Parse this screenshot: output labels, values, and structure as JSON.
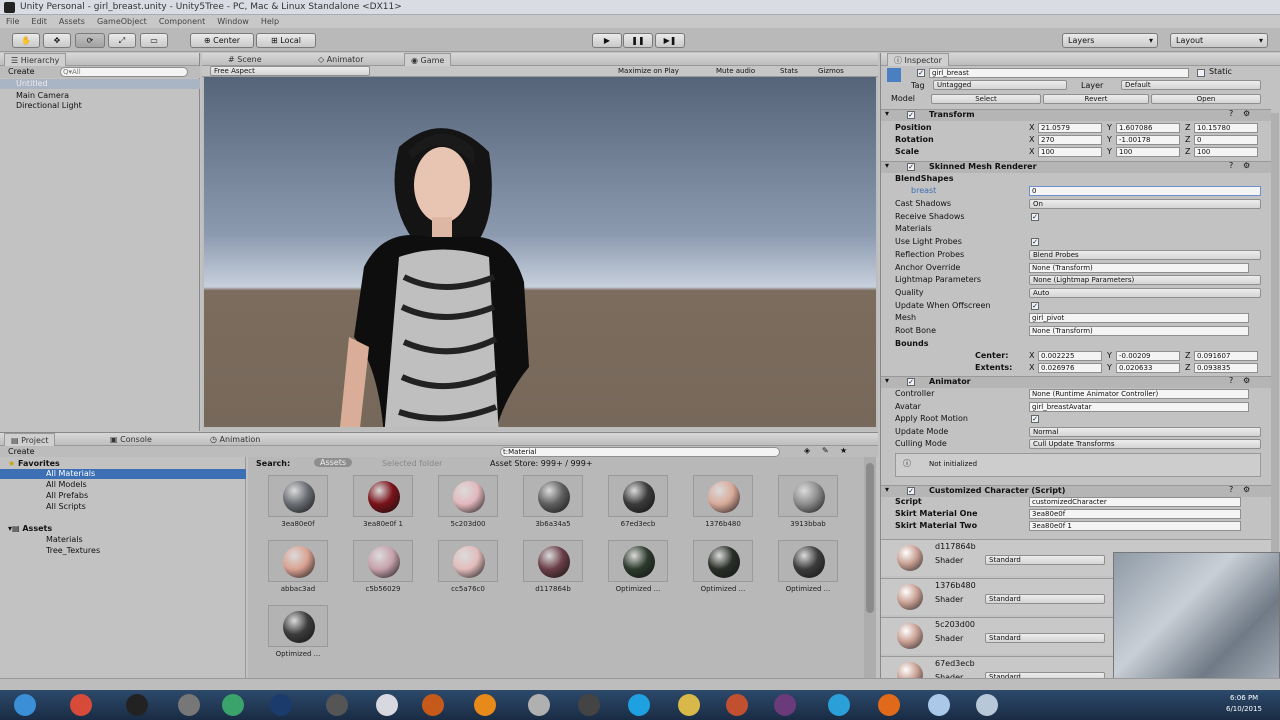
{
  "window": {
    "title": "Unity Personal - girl_breast.unity - Unity5Tree - PC, Mac & Linux Standalone <DX11>"
  },
  "menu": [
    "File",
    "Edit",
    "Assets",
    "GameObject",
    "Component",
    "Window",
    "Help"
  ],
  "toolbar": {
    "center": "Center",
    "local": "Local",
    "layers": "Layers",
    "layout": "Layout"
  },
  "hierarchy": {
    "tab": "Hierarchy",
    "create": "Create",
    "search": "Q▾All",
    "items": [
      "Untitled",
      "Main Camera",
      "Directional Light"
    ]
  },
  "scene_tabs": {
    "scene": "Scene",
    "animator": "Animator",
    "game": "Game",
    "aspect": "Free Aspect",
    "buttons": [
      "Maximize on Play",
      "Mute audio",
      "Stats",
      "Gizmos"
    ]
  },
  "inspector": {
    "tab": "Inspector",
    "object": "girl_breast",
    "static": "Static",
    "tag_label": "Tag",
    "tag": "Untagged",
    "layer_label": "Layer",
    "layer": "Default",
    "model_label": "Model",
    "model_buttons": [
      "Select",
      "Revert",
      "Open"
    ],
    "transform": {
      "title": "Transform",
      "rows": [
        {
          "label": "Position",
          "x": "21.0579",
          "y": "1.607086",
          "z": "10.15780"
        },
        {
          "label": "Rotation",
          "x": "270",
          "y": "-1.00178",
          "z": "0"
        },
        {
          "label": "Scale",
          "x": "100",
          "y": "100",
          "z": "100"
        }
      ]
    },
    "smr": {
      "title": "Skinned Mesh Renderer",
      "blendshapes": "BlendShapes",
      "breast_label": "breast",
      "breast": "0",
      "rows": [
        {
          "label": "Cast Shadows",
          "value": "On",
          "kind": "dd"
        },
        {
          "label": "Receive Shadows",
          "value": "",
          "kind": "cb"
        },
        {
          "label": "Materials",
          "value": "",
          "kind": "none"
        },
        {
          "label": "Use Light Probes",
          "value": "",
          "kind": "cb"
        },
        {
          "label": "Reflection Probes",
          "value": "Blend Probes",
          "kind": "dd"
        },
        {
          "label": "Anchor Override",
          "value": "None (Transform)",
          "kind": "field"
        },
        {
          "label": "Lightmap Parameters",
          "value": "None (Lightmap Parameters)",
          "kind": "dd"
        },
        {
          "label": "Quality",
          "value": "Auto",
          "kind": "dd"
        },
        {
          "label": "Update When Offscreen",
          "value": "",
          "kind": "cb"
        },
        {
          "label": "Mesh",
          "value": "girl_pivot",
          "kind": "field"
        },
        {
          "label": "Root Bone",
          "value": "None (Transform)",
          "kind": "field"
        }
      ],
      "bounds": "Bounds",
      "center_label": "Center:",
      "center": {
        "x": "0.002225",
        "y": "-0.00209",
        "z": "0.091607"
      },
      "extents_label": "Extents:",
      "extents": {
        "x": "0.026976",
        "y": "0.020633",
        "z": "0.093835"
      }
    },
    "animator": {
      "title": "Animator",
      "rows": [
        {
          "label": "Controller",
          "value": "None (Runtime Animator Controller)",
          "kind": "field"
        },
        {
          "label": "Avatar",
          "value": "girl_breastAvatar",
          "kind": "field"
        },
        {
          "label": "Apply Root Motion",
          "value": "",
          "kind": "cb"
        },
        {
          "label": "Update Mode",
          "value": "Normal",
          "kind": "dd"
        },
        {
          "label": "Culling Mode",
          "value": "Cull Update Transforms",
          "kind": "dd"
        }
      ],
      "note": "Not initialized"
    },
    "custom": {
      "title": "Customized Character (Script)",
      "rows": [
        {
          "label": "Script",
          "value": "customizedCharacter"
        },
        {
          "label": "Skirt Material One",
          "value": "3ea80e0f"
        },
        {
          "label": "Skirt Material Two",
          "value": "3ea80e0f 1"
        }
      ]
    },
    "materials": [
      {
        "name": "d117864b",
        "shader_label": "Shader",
        "shader": "Standard"
      },
      {
        "name": "1376b480",
        "shader_label": "Shader",
        "shader": "Standard"
      },
      {
        "name": "5c203d00",
        "shader_label": "Shader",
        "shader": "Standard"
      },
      {
        "name": "67ed3ecb",
        "shader_label": "Shader",
        "shader": "Standard"
      }
    ]
  },
  "project": {
    "tab": "Project",
    "console": "Console",
    "animation": "Animation",
    "create": "Create",
    "search_text": "t:Material",
    "favorites": "Favorites",
    "fav_items": [
      "All Materials",
      "All Models",
      "All Prefabs",
      "All Scripts"
    ],
    "assets": "Assets",
    "asset_items": [
      "Materials",
      "Tree_Textures"
    ],
    "search_label": "Search:",
    "scope_assets": "Assets",
    "scope_folder": "Selected folder",
    "store": "Asset Store: 999+ / 999+",
    "thumbs": [
      "3ea80e0f",
      "3ea80e0f 1",
      "5c203d00",
      "3b6a34a5",
      "67ed3ecb",
      "1376b480",
      "3913bbab",
      "abbac3ad",
      "c5b56029",
      "cc5a76c0",
      "d117864b",
      "Optimized ...",
      "Optimized ...",
      "Optimized ...",
      "Optimized ..."
    ]
  },
  "colors": {
    "sky_top": "#58657a",
    "sky_bottom": "#c3ccd9",
    "ground": "#7a6a5c",
    "panel": "#c2c2c2",
    "selection": "#3d6fb5"
  },
  "taskbar": {
    "time": "6:06 PM",
    "date": "6/10/2015"
  }
}
